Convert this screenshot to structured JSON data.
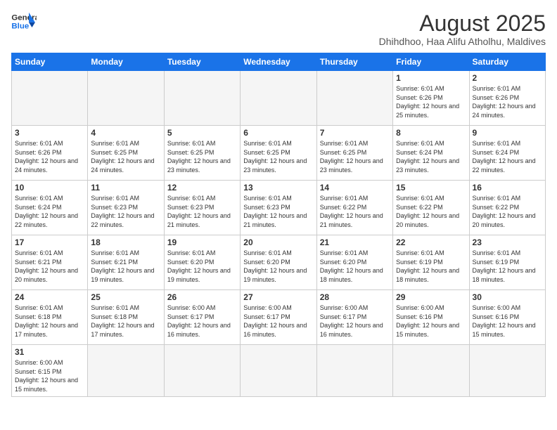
{
  "header": {
    "logo": {
      "general": "General",
      "blue": "Blue"
    },
    "title": "August 2025",
    "subtitle": "Dhihdhoo, Haa Alifu Atholhu, Maldives"
  },
  "weekdays": [
    "Sunday",
    "Monday",
    "Tuesday",
    "Wednesday",
    "Thursday",
    "Friday",
    "Saturday"
  ],
  "weeks": [
    [
      {
        "day": "",
        "info": "",
        "empty": true
      },
      {
        "day": "",
        "info": "",
        "empty": true
      },
      {
        "day": "",
        "info": "",
        "empty": true
      },
      {
        "day": "",
        "info": "",
        "empty": true
      },
      {
        "day": "",
        "info": "",
        "empty": true
      },
      {
        "day": "1",
        "info": "Sunrise: 6:01 AM\nSunset: 6:26 PM\nDaylight: 12 hours\nand 25 minutes."
      },
      {
        "day": "2",
        "info": "Sunrise: 6:01 AM\nSunset: 6:26 PM\nDaylight: 12 hours\nand 24 minutes."
      }
    ],
    [
      {
        "day": "3",
        "info": "Sunrise: 6:01 AM\nSunset: 6:26 PM\nDaylight: 12 hours\nand 24 minutes."
      },
      {
        "day": "4",
        "info": "Sunrise: 6:01 AM\nSunset: 6:25 PM\nDaylight: 12 hours\nand 24 minutes."
      },
      {
        "day": "5",
        "info": "Sunrise: 6:01 AM\nSunset: 6:25 PM\nDaylight: 12 hours\nand 23 minutes."
      },
      {
        "day": "6",
        "info": "Sunrise: 6:01 AM\nSunset: 6:25 PM\nDaylight: 12 hours\nand 23 minutes."
      },
      {
        "day": "7",
        "info": "Sunrise: 6:01 AM\nSunset: 6:25 PM\nDaylight: 12 hours\nand 23 minutes."
      },
      {
        "day": "8",
        "info": "Sunrise: 6:01 AM\nSunset: 6:24 PM\nDaylight: 12 hours\nand 23 minutes."
      },
      {
        "day": "9",
        "info": "Sunrise: 6:01 AM\nSunset: 6:24 PM\nDaylight: 12 hours\nand 22 minutes."
      }
    ],
    [
      {
        "day": "10",
        "info": "Sunrise: 6:01 AM\nSunset: 6:24 PM\nDaylight: 12 hours\nand 22 minutes."
      },
      {
        "day": "11",
        "info": "Sunrise: 6:01 AM\nSunset: 6:23 PM\nDaylight: 12 hours\nand 22 minutes."
      },
      {
        "day": "12",
        "info": "Sunrise: 6:01 AM\nSunset: 6:23 PM\nDaylight: 12 hours\nand 21 minutes."
      },
      {
        "day": "13",
        "info": "Sunrise: 6:01 AM\nSunset: 6:23 PM\nDaylight: 12 hours\nand 21 minutes."
      },
      {
        "day": "14",
        "info": "Sunrise: 6:01 AM\nSunset: 6:22 PM\nDaylight: 12 hours\nand 21 minutes."
      },
      {
        "day": "15",
        "info": "Sunrise: 6:01 AM\nSunset: 6:22 PM\nDaylight: 12 hours\nand 20 minutes."
      },
      {
        "day": "16",
        "info": "Sunrise: 6:01 AM\nSunset: 6:22 PM\nDaylight: 12 hours\nand 20 minutes."
      }
    ],
    [
      {
        "day": "17",
        "info": "Sunrise: 6:01 AM\nSunset: 6:21 PM\nDaylight: 12 hours\nand 20 minutes."
      },
      {
        "day": "18",
        "info": "Sunrise: 6:01 AM\nSunset: 6:21 PM\nDaylight: 12 hours\nand 19 minutes."
      },
      {
        "day": "19",
        "info": "Sunrise: 6:01 AM\nSunset: 6:20 PM\nDaylight: 12 hours\nand 19 minutes."
      },
      {
        "day": "20",
        "info": "Sunrise: 6:01 AM\nSunset: 6:20 PM\nDaylight: 12 hours\nand 19 minutes."
      },
      {
        "day": "21",
        "info": "Sunrise: 6:01 AM\nSunset: 6:20 PM\nDaylight: 12 hours\nand 18 minutes."
      },
      {
        "day": "22",
        "info": "Sunrise: 6:01 AM\nSunset: 6:19 PM\nDaylight: 12 hours\nand 18 minutes."
      },
      {
        "day": "23",
        "info": "Sunrise: 6:01 AM\nSunset: 6:19 PM\nDaylight: 12 hours\nand 18 minutes."
      }
    ],
    [
      {
        "day": "24",
        "info": "Sunrise: 6:01 AM\nSunset: 6:18 PM\nDaylight: 12 hours\nand 17 minutes."
      },
      {
        "day": "25",
        "info": "Sunrise: 6:01 AM\nSunset: 6:18 PM\nDaylight: 12 hours\nand 17 minutes."
      },
      {
        "day": "26",
        "info": "Sunrise: 6:00 AM\nSunset: 6:17 PM\nDaylight: 12 hours\nand 16 minutes."
      },
      {
        "day": "27",
        "info": "Sunrise: 6:00 AM\nSunset: 6:17 PM\nDaylight: 12 hours\nand 16 minutes."
      },
      {
        "day": "28",
        "info": "Sunrise: 6:00 AM\nSunset: 6:17 PM\nDaylight: 12 hours\nand 16 minutes."
      },
      {
        "day": "29",
        "info": "Sunrise: 6:00 AM\nSunset: 6:16 PM\nDaylight: 12 hours\nand 15 minutes."
      },
      {
        "day": "30",
        "info": "Sunrise: 6:00 AM\nSunset: 6:16 PM\nDaylight: 12 hours\nand 15 minutes."
      }
    ],
    [
      {
        "day": "31",
        "info": "Sunrise: 6:00 AM\nSunset: 6:15 PM\nDaylight: 12 hours\nand 15 minutes.",
        "last": true
      },
      {
        "day": "",
        "info": "",
        "empty": true,
        "last": true
      },
      {
        "day": "",
        "info": "",
        "empty": true,
        "last": true
      },
      {
        "day": "",
        "info": "",
        "empty": true,
        "last": true
      },
      {
        "day": "",
        "info": "",
        "empty": true,
        "last": true
      },
      {
        "day": "",
        "info": "",
        "empty": true,
        "last": true
      },
      {
        "day": "",
        "info": "",
        "empty": true,
        "last": true
      }
    ]
  ]
}
